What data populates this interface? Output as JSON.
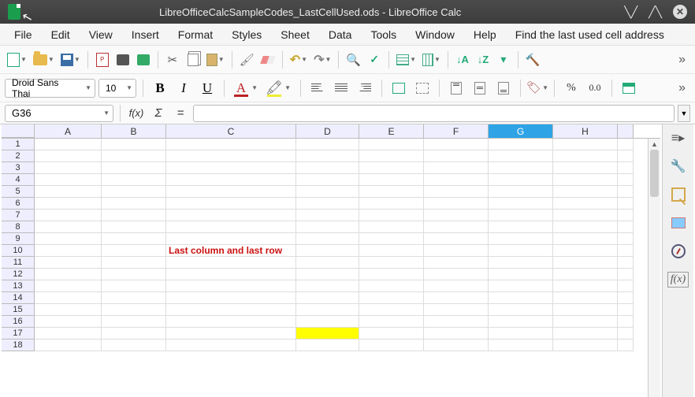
{
  "window": {
    "title": "LibreOfficeCalcSampleCodes_LastCellUsed.ods - LibreOffice Calc"
  },
  "menubar": {
    "items": [
      "File",
      "Edit",
      "View",
      "Insert",
      "Format",
      "Styles",
      "Sheet",
      "Data",
      "Tools",
      "Window",
      "Help",
      "Find the last used cell address"
    ]
  },
  "font": {
    "name": "Droid Sans Thai",
    "size": "10"
  },
  "format": {
    "percent": "%",
    "number": "0.0"
  },
  "formula_bar": {
    "cell_ref": "G36",
    "fx_label": "f(x)",
    "sigma": "Σ",
    "eq": "=",
    "formula": ""
  },
  "grid": {
    "columns": [
      "A",
      "B",
      "C",
      "D",
      "E",
      "F",
      "G",
      "H",
      ""
    ],
    "selected_col": "G",
    "rows": [
      1,
      2,
      3,
      4,
      5,
      6,
      7,
      8,
      9,
      10,
      11,
      12,
      13,
      14,
      15,
      16,
      17,
      18
    ],
    "selected_row": null,
    "cells": {
      "C10": "Last column and last row"
    },
    "yellow_cell": "D17"
  }
}
